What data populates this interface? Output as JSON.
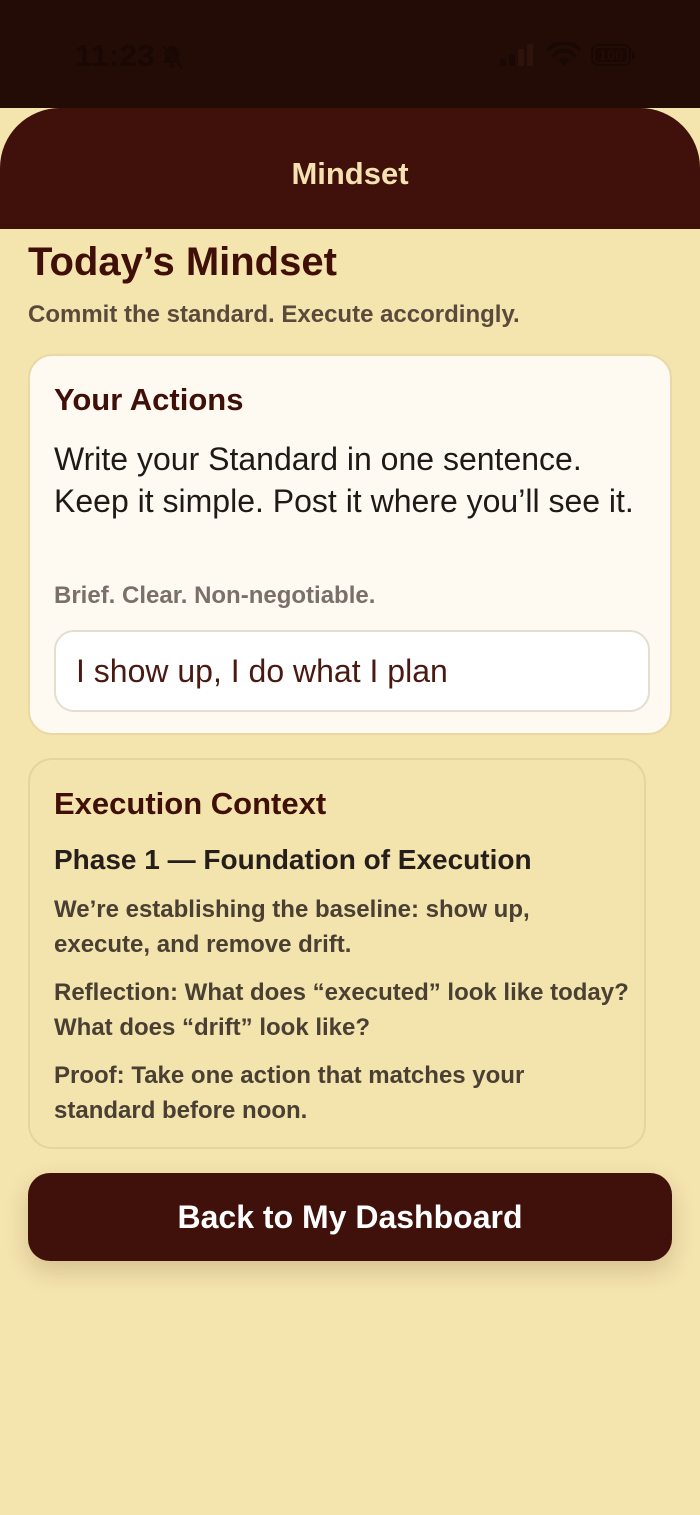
{
  "status_bar": {
    "time": "11:23",
    "battery": "100",
    "icons": [
      "bell-slash-icon",
      "signal-icon",
      "wifi-icon",
      "battery-icon"
    ]
  },
  "header": {
    "title": "Mindset"
  },
  "page": {
    "title": "Today’s Mindset",
    "subtitle": "Commit the standard. Execute accordingly."
  },
  "actions_card": {
    "title": "Your Actions",
    "body": "Write your Standard in one sentence. Keep it simple. Post it where you’ll see it.",
    "note": "Brief. Clear. Non-negotiable.",
    "standard_value": "I show up, I do what I plan"
  },
  "context_card": {
    "title": "Execution Context",
    "phase": "Phase 1 — Foundation of Execution",
    "description": "We’re establishing the baseline: show up, execute, and remove drift.",
    "reflection": "Reflection: What does “executed” look like today? What does “drift” look like?",
    "proof": "Proof: Take one action that matches your standard before noon."
  },
  "footer": {
    "dashboard_button": "Back to My Dashboard"
  },
  "colors": {
    "background": "#f4e4ae",
    "header": "#40110a",
    "status_bar": "#230b06",
    "accent_text": "#3f0f08",
    "header_text": "#f6e2b0"
  }
}
